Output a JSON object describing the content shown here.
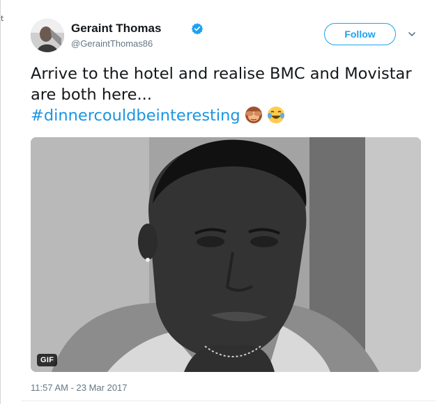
{
  "edge": {
    "glyph": "t"
  },
  "author": {
    "display_name": "Geraint Thomas",
    "handle": "@GeraintThomas86",
    "verified": true,
    "verified_color": "#1da1f2",
    "avatar_icon": "profile-photo"
  },
  "actions": {
    "follow_label": "Follow",
    "follow_color": "#1da1f2",
    "menu_icon": "chevron-down-icon"
  },
  "tweet": {
    "text_line": "Arrive to the hotel and realise BMC and Movistar are both here...",
    "hashtag": "#dinnercouldbeinteresting",
    "hashtag_color": "#1b95e0",
    "emojis": [
      "see-no-evil-monkey",
      "face-with-tears-of-joy"
    ]
  },
  "media": {
    "type": "gif",
    "badge_label": "GIF",
    "subject": "grayscale-reaction-gif-man"
  },
  "meta": {
    "timestamp": "11:57 AM - 23 Mar 2017"
  }
}
